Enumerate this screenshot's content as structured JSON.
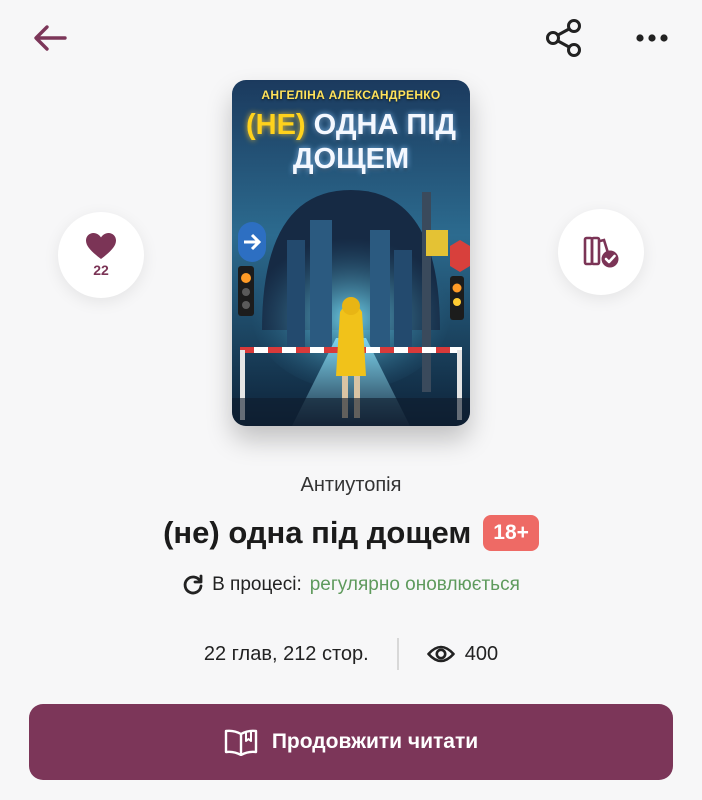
{
  "colors": {
    "accent": "#7c3659",
    "age_badge": "#ee6a65",
    "status_green": "#5e9a5c"
  },
  "header": {
    "back_icon": "arrow-left-icon",
    "share_icon": "share-icon",
    "more_icon": "more-horizontal-icon"
  },
  "cover": {
    "author": "АНГЕЛІНА АЛЕКСАНДРЕНКО",
    "title_highlight": "(НЕ)",
    "title_rest_line1": "ОДНА ПІД",
    "title_line2": "ДОЩЕМ"
  },
  "like": {
    "icon": "heart-icon",
    "count": "22"
  },
  "library": {
    "icon": "library-check-icon"
  },
  "book": {
    "genre": "Антиутопія",
    "title": "(не) одна під дощем",
    "age_rating": "18+",
    "status_icon": "refresh-icon",
    "status_label": "В процесі:",
    "status_value": "регулярно оновлюється",
    "chapters_pages": "22 глав, 212 стор.",
    "views_icon": "eye-icon",
    "views": "400"
  },
  "actions": {
    "continue_icon": "open-book-icon",
    "continue_label": "Продовжити читати"
  }
}
